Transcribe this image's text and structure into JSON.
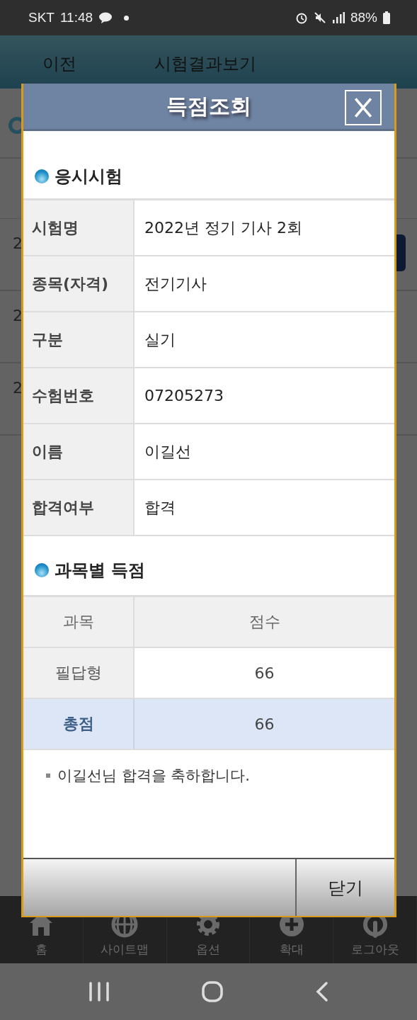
{
  "status_bar": {
    "carrier": "SKT",
    "time": "11:48",
    "battery": "88%"
  },
  "header": {
    "back": "이전",
    "title": "시험결과보기"
  },
  "background_rows": [
    "2",
    "2",
    "2"
  ],
  "dialog": {
    "title": "득점조회",
    "exam_section": {
      "title": "응시시험",
      "rows": [
        {
          "label": "시험명",
          "value": "2022년 정기 기사 2회"
        },
        {
          "label": "종목(자격)",
          "value": "전기기사"
        },
        {
          "label": "구분",
          "value": "실기"
        },
        {
          "label": "수험번호",
          "value": "07205273"
        },
        {
          "label": "이름",
          "value": "이길선"
        },
        {
          "label": "합격여부",
          "value": "합격"
        }
      ]
    },
    "score_section": {
      "title": "과목별 득점",
      "columns": [
        "과목",
        "점수"
      ],
      "rows": [
        {
          "kind": "subject",
          "subject": "필답형",
          "score": "66"
        },
        {
          "kind": "total",
          "subject": "총점",
          "score": "66"
        }
      ]
    },
    "message": "이길선님 합격을 축하합니다.",
    "close_button": "닫기"
  },
  "bottom_nav": [
    {
      "kind": "home",
      "label": "홈"
    },
    {
      "kind": "sitemap",
      "label": "사이트맵"
    },
    {
      "kind": "options",
      "label": "옵션"
    },
    {
      "kind": "zoom",
      "label": "확대"
    },
    {
      "kind": "logout",
      "label": "로그아웃"
    }
  ]
}
